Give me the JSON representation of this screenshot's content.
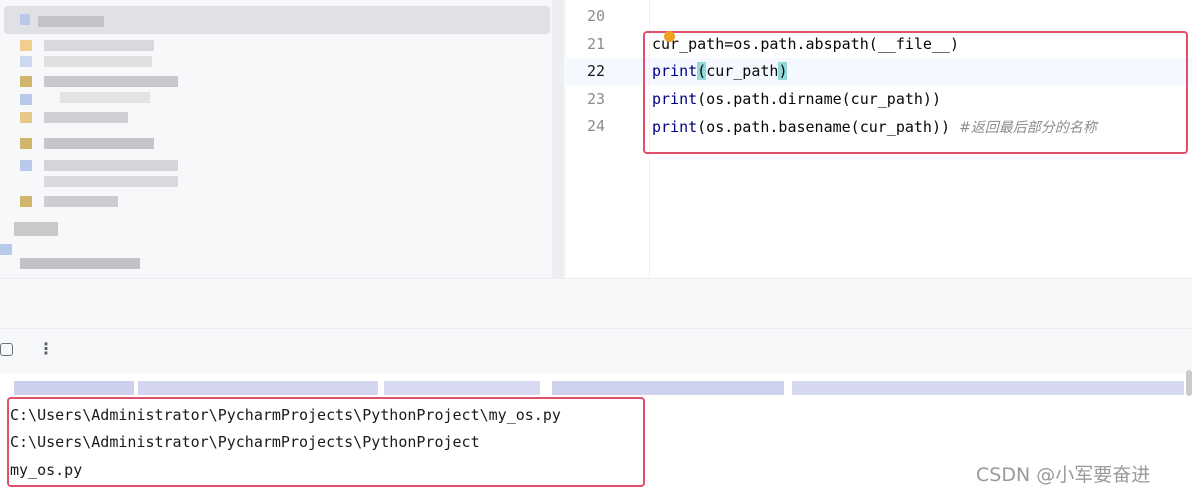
{
  "editor": {
    "line_numbers": [
      "20",
      "21",
      "22",
      "23",
      "24"
    ],
    "current_line": "22",
    "code": {
      "line21": "cur_path=os.path.abspath(__file__)",
      "line22_kw": "print",
      "line22_open": "(",
      "line22_arg": "cur_path",
      "line22_close": ")",
      "line23_kw": "print",
      "line23_rest": "(os.path.dirname(cur_path))",
      "line24_kw": "print",
      "line24_rest": "(os.path.basename(cur_path)) ",
      "line24_comment": "#返回最后部分的名称"
    }
  },
  "run_panel": {
    "output_lines": [
      "C:\\Users\\Administrator\\PycharmProjects\\PythonProject\\my_os.py",
      "C:\\Users\\Administrator\\PycharmProjects\\PythonProject",
      "my_os.py"
    ],
    "more_icon": "⋮"
  },
  "watermark": "CSDN @小军要奋进",
  "colors": {
    "highlight_box": "#e0506a",
    "keyword": "#000080",
    "bracket_match": "#93d9d9",
    "comment": "#8c8c8c"
  },
  "icons": [
    "breakpoint-dot-icon",
    "stop-icon",
    "more-vertical-icon"
  ]
}
